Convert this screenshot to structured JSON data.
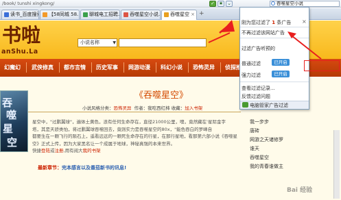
{
  "browser": {
    "url": "/book/ tunshi xingkong/",
    "search": "吞噬星空小说",
    "tabs": [
      {
        "label": "读书_百度搜索"
      },
      {
        "label": "【58同城 58..."
      },
      {
        "label": "聊城电工招聘..."
      },
      {
        "label": "吞噬星空小说..."
      },
      {
        "label": "吞噬星空"
      }
    ],
    "new_tab": "+"
  },
  "site": {
    "logo_cn": "书啦",
    "logo_en": "anShu.La",
    "search_type": "小说名称",
    "search_type_arrow": "▼"
  },
  "nav": {
    "items": [
      "幻魔幻",
      "武侠修真",
      "都市言情",
      "历史军事",
      "网游动漫",
      "科幻小说",
      "恐怖灵异",
      "侦探推理"
    ]
  },
  "book": {
    "title": "《吞噬星空》",
    "meta_prefix": "小说风格分类：",
    "genre": "恐怖灵异",
    "meta_mid": "作者：我吃西红柿 收藏：",
    "bookmark": "加入书架",
    "cover_text_1": "吞",
    "cover_text_2": "噬",
    "cover_text_3": "星",
    "cover_text_4": "空",
    "description_lines": [
      "星空中，\"过鹏翼球\"，遍体土黄色，浪有任何生命存在，直径21000公里，噢，竟然藏在'星际金字",
      "塔，其是天骄类怕，将过鹏翼球吞噬回去，竟则实力是吞噬星空的80x，\"能色吞白的罗峰自",
      "都要生在一颗飞行的陨石上，遥看远远的一颗死生命存在的行星，在那行星地，看那第六部小说《吞噬星",
      "空》正式上传，因为大家黑名让一个成属于地球，神秘真强的本来世界。"
    ],
    "fast_prefix": "快捷",
    "login": "登陆",
    "fast_mid": "或",
    "register": "注册",
    "fast_suffix": ",用有阅大",
    "my_shelf": "我的书架",
    "latest_label": "最新章节：",
    "latest_link": "完本感言以及番茄新书的讯息!"
  },
  "side": {
    "items": [
      "我一步步",
      "唐砖",
      "网游之天诸修罗",
      "谁天",
      "吞噬星空",
      "我的青春谁做主"
    ]
  },
  "popup": {
    "count_prefix": "刚为您过滤了",
    "count_value": "1",
    "count_suffix": "条广告",
    "close": "×",
    "no_filter": "不再过滤该网站广告",
    "desc": "过滤广告听预的",
    "normal_label": "普通过滤",
    "normal_btn": "已开启",
    "strong_label": "强力过滤",
    "strong_btn": "已开启",
    "view_records": "查看过滤记录...",
    "feedback": "反馈过滤问题",
    "footer": "电脑管家广告过滤"
  },
  "annotation": {
    "color": "#e81e1e"
  },
  "watermark": "Bai  经验"
}
